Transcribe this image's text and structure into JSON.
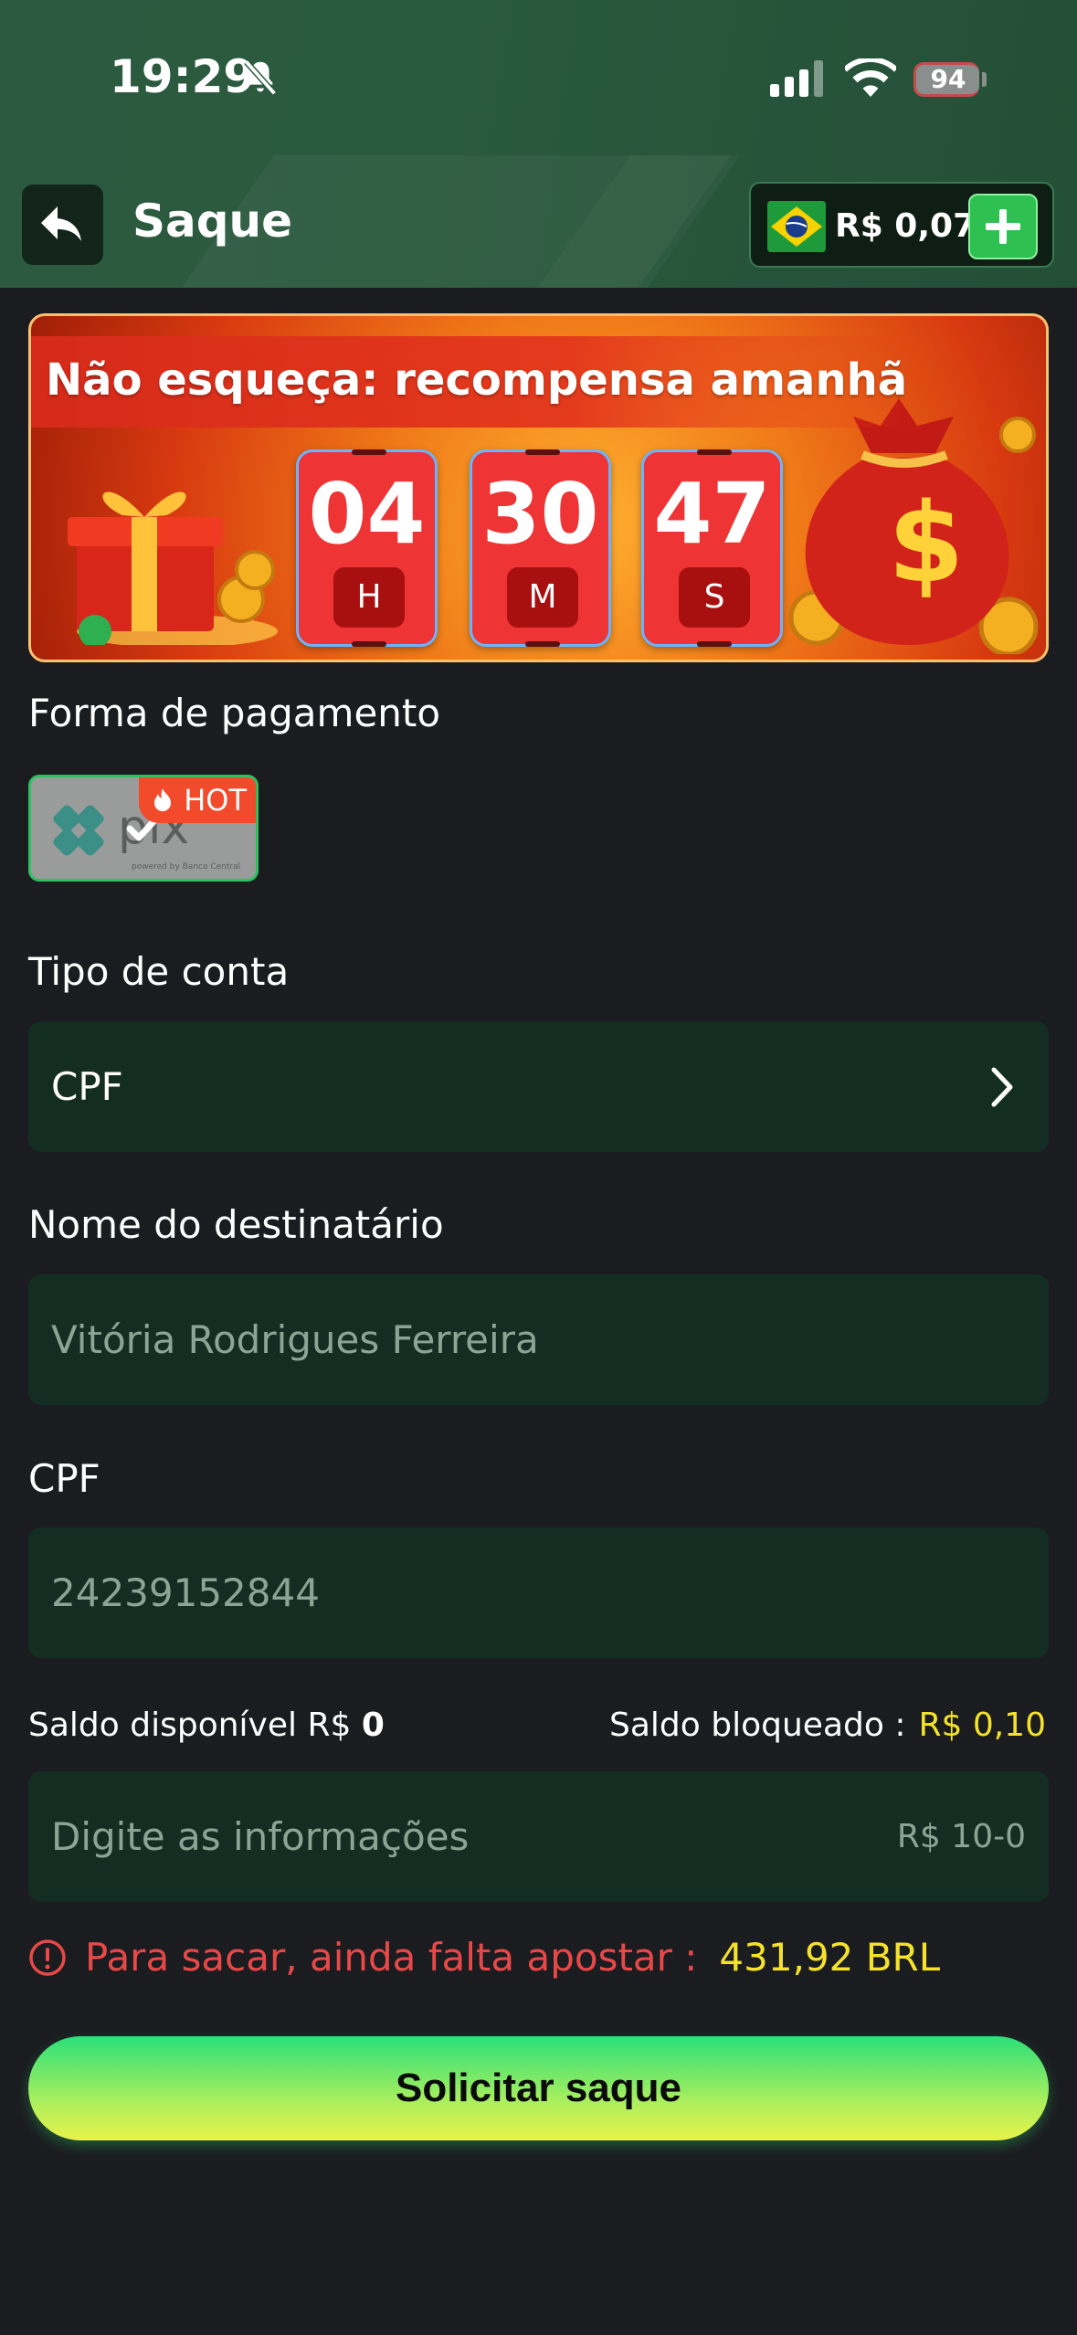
{
  "status_bar": {
    "time": "19:29",
    "battery": "94"
  },
  "header": {
    "title": "Saque",
    "balance": "R$ 0,07"
  },
  "banner": {
    "title": "Não esqueça: recompensa amanhã",
    "timer": [
      {
        "value": "04",
        "unit": "H"
      },
      {
        "value": "30",
        "unit": "M"
      },
      {
        "value": "47",
        "unit": "S"
      }
    ]
  },
  "payment": {
    "label": "Forma de pagamento",
    "method_badge": "HOT",
    "method_name": "pix",
    "method_caption": "powered by Banco Central"
  },
  "account_type": {
    "label": "Tipo de conta",
    "value": "CPF"
  },
  "recipient": {
    "label": "Nome do destinatário",
    "value": "Vitória Rodrigues Ferreira"
  },
  "cpf": {
    "label": "CPF",
    "value": "24239152844"
  },
  "balance_info": {
    "available_label": "Saldo disponível R$",
    "available_value": "0",
    "blocked_label": "Saldo bloqueado :",
    "blocked_value": "R$ 0,10"
  },
  "amount": {
    "placeholder": "Digite as informações",
    "range": "R$ 10-0"
  },
  "warning": {
    "text": "Para sacar, ainda falta apostar :",
    "amount": "431,92 BRL"
  },
  "submit_label": "Solicitar saque",
  "colors": {
    "accent_green": "#2ec050",
    "warning_red": "#e84848",
    "highlight_yellow": "#f5e22a",
    "field_bg": "#142d22"
  }
}
